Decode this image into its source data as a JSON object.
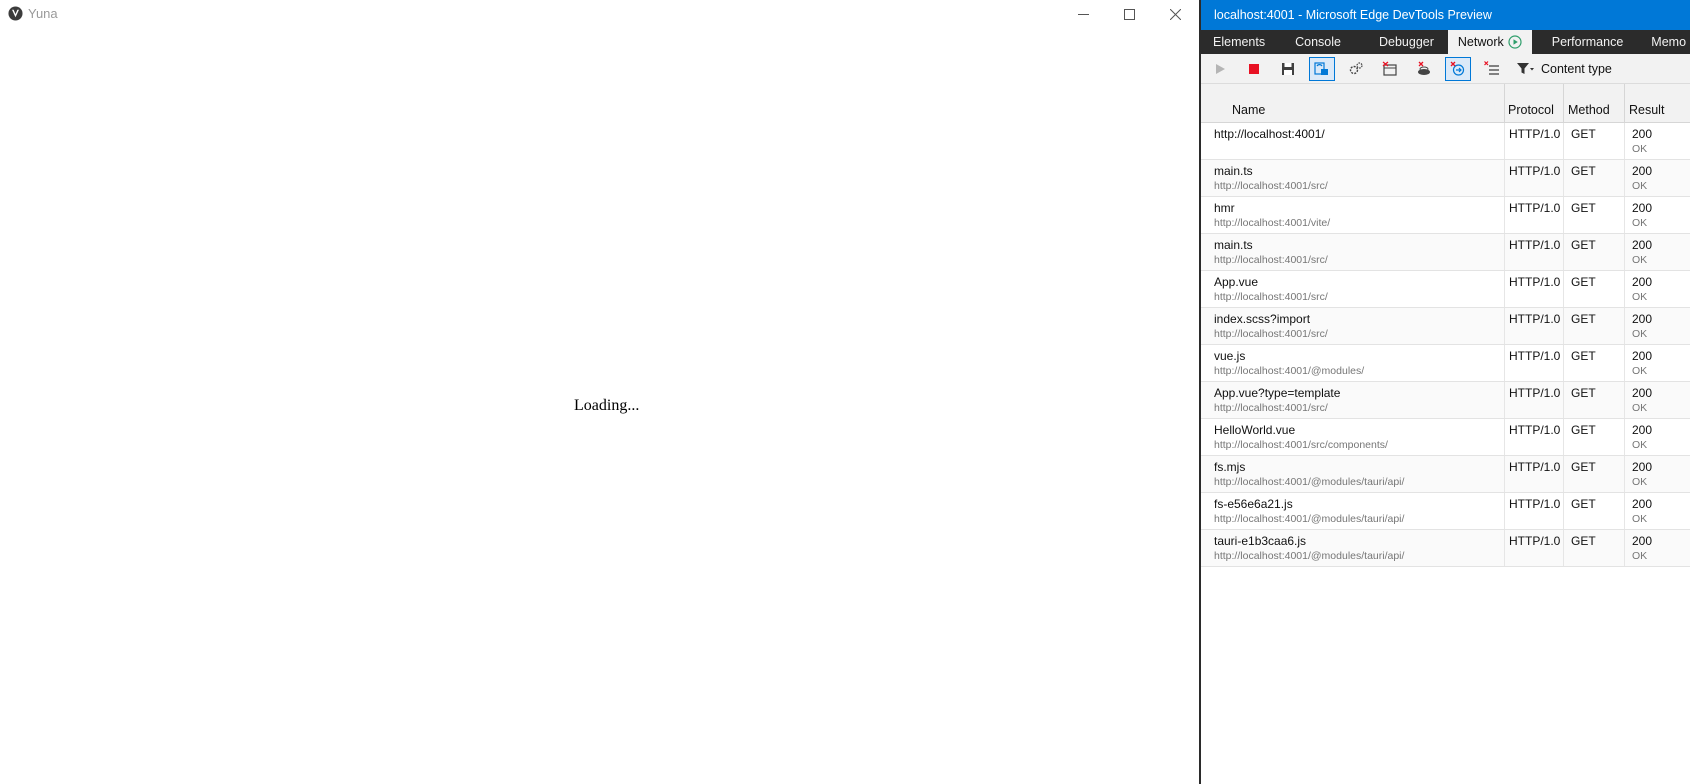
{
  "app": {
    "title": "Yuna",
    "loading_text": "Loading..."
  },
  "devtools": {
    "title": "localhost:4001 - Microsoft Edge DevTools Preview",
    "tabs": [
      {
        "label": "Elements"
      },
      {
        "label": "Console"
      },
      {
        "label": "Debugger"
      },
      {
        "label": "Network"
      },
      {
        "label": "Performance"
      },
      {
        "label": "Memo"
      }
    ],
    "active_tab": "Network",
    "toolbar": {
      "filter_label": "Content type"
    },
    "columns": {
      "name": "Name",
      "protocol": "Protocol",
      "method": "Method",
      "result": "Result"
    },
    "requests": [
      {
        "name": "http://localhost:4001/",
        "path": "",
        "protocol": "HTTP/1.0",
        "method": "GET",
        "status": "200",
        "status_text": "OK"
      },
      {
        "name": "main.ts",
        "path": "http://localhost:4001/src/",
        "protocol": "HTTP/1.0",
        "method": "GET",
        "status": "200",
        "status_text": "OK"
      },
      {
        "name": "hmr",
        "path": "http://localhost:4001/vite/",
        "protocol": "HTTP/1.0",
        "method": "GET",
        "status": "200",
        "status_text": "OK"
      },
      {
        "name": "main.ts",
        "path": "http://localhost:4001/src/",
        "protocol": "HTTP/1.0",
        "method": "GET",
        "status": "200",
        "status_text": "OK"
      },
      {
        "name": "App.vue",
        "path": "http://localhost:4001/src/",
        "protocol": "HTTP/1.0",
        "method": "GET",
        "status": "200",
        "status_text": "OK"
      },
      {
        "name": "index.scss?import",
        "path": "http://localhost:4001/src/",
        "protocol": "HTTP/1.0",
        "method": "GET",
        "status": "200",
        "status_text": "OK"
      },
      {
        "name": "vue.js",
        "path": "http://localhost:4001/@modules/",
        "protocol": "HTTP/1.0",
        "method": "GET",
        "status": "200",
        "status_text": "OK"
      },
      {
        "name": "App.vue?type=template",
        "path": "http://localhost:4001/src/",
        "protocol": "HTTP/1.0",
        "method": "GET",
        "status": "200",
        "status_text": "OK"
      },
      {
        "name": "HelloWorld.vue",
        "path": "http://localhost:4001/src/components/",
        "protocol": "HTTP/1.0",
        "method": "GET",
        "status": "200",
        "status_text": "OK"
      },
      {
        "name": "fs.mjs",
        "path": "http://localhost:4001/@modules/tauri/api/",
        "protocol": "HTTP/1.0",
        "method": "GET",
        "status": "200",
        "status_text": "OK"
      },
      {
        "name": "fs-e56e6a21.js",
        "path": "http://localhost:4001/@modules/tauri/api/",
        "protocol": "HTTP/1.0",
        "method": "GET",
        "status": "200",
        "status_text": "OK"
      },
      {
        "name": "tauri-e1b3caa6.js",
        "path": "http://localhost:4001/@modules/tauri/api/",
        "protocol": "HTTP/1.0",
        "method": "GET",
        "status": "200",
        "status_text": "OK"
      }
    ]
  },
  "colors": {
    "titlebar": "#0078d7",
    "tabbar": "#2b2b2b",
    "stop": "#e81123"
  }
}
